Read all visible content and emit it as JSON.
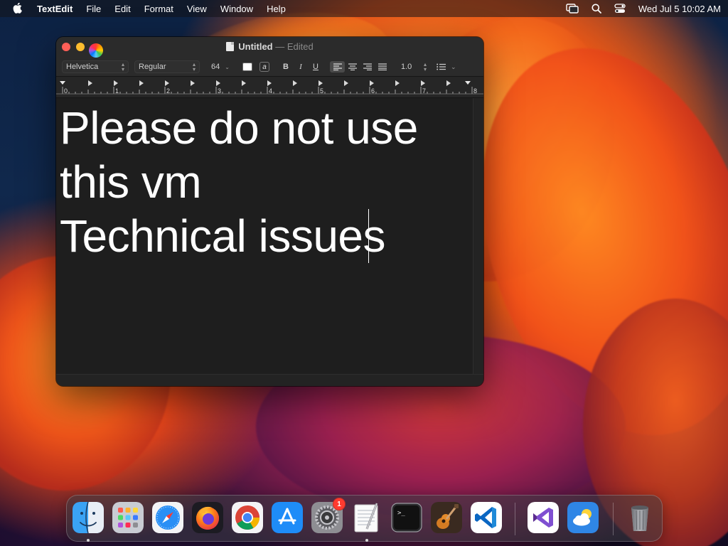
{
  "menubar": {
    "app_name": "TextEdit",
    "items": [
      "File",
      "Edit",
      "Format",
      "View",
      "Window",
      "Help"
    ],
    "clock": "Wed Jul 5  10:02 AM"
  },
  "window": {
    "doc_name": "Untitled",
    "separator": "—",
    "status": "Edited",
    "format_bar": {
      "font_family": "Helvetica",
      "font_style": "Regular",
      "font_size": "64",
      "bold": "B",
      "italic": "I",
      "underline": "U",
      "highlight": "a",
      "line_spacing": "1.0"
    },
    "ruler_numbers": [
      "0",
      "1",
      "2",
      "3",
      "4",
      "5",
      "6",
      "7",
      "8"
    ],
    "text_lines": [
      "Please do not use",
      "this vm",
      "Technical issues"
    ]
  },
  "dock": {
    "apps": [
      {
        "name": "Finder",
        "icon": "finder-icon",
        "running": true
      },
      {
        "name": "Launchpad",
        "icon": "launchpad-icon"
      },
      {
        "name": "Safari",
        "icon": "safari-icon"
      },
      {
        "name": "Firefox",
        "icon": "firefox-icon"
      },
      {
        "name": "Google Chrome",
        "icon": "chrome-icon"
      },
      {
        "name": "App Store",
        "icon": "app-store-icon"
      },
      {
        "name": "System Settings",
        "icon": "system-settings-icon",
        "badge": "1"
      },
      {
        "name": "TextEdit",
        "icon": "textedit-icon",
        "running": true
      },
      {
        "name": "Terminal",
        "icon": "terminal-icon"
      },
      {
        "name": "GarageBand",
        "icon": "garageband-icon"
      },
      {
        "name": "Visual Studio Code",
        "icon": "vscode-icon"
      },
      {
        "name": "Visual Studio",
        "icon": "visual-studio-icon"
      },
      {
        "name": "Weather",
        "icon": "weather-icon"
      },
      {
        "name": "Trash",
        "icon": "trash-icon"
      }
    ],
    "badge_text": "1"
  },
  "colors": {
    "close": "#ff5f57",
    "minimize": "#febc2e",
    "badge": "#ff3b30"
  }
}
